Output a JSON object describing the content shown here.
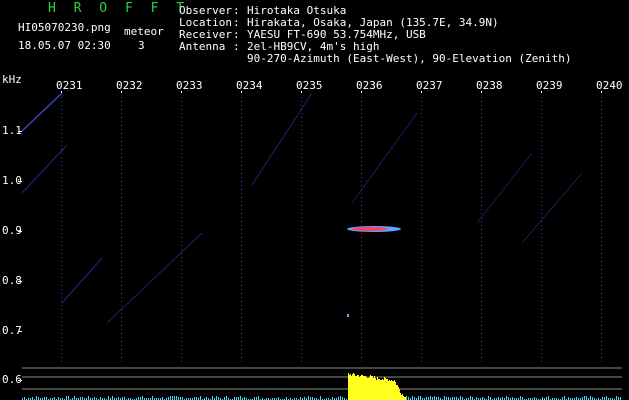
{
  "brand": "H R O F F T",
  "file_name": "HI05070230.png",
  "datetime": "18.05.07 02:30",
  "meteor_label": "meteor",
  "meteor_count": "3",
  "station": {
    "rows": [
      {
        "key": "Observer",
        "value": "Hirotaka Otsuka"
      },
      {
        "key": "Location",
        "value": "Hirakata, Osaka, Japan (135.7E, 34.9N)"
      },
      {
        "key": "Receiver",
        "value": "YAESU FT-690 53.754MHz, USB"
      },
      {
        "key": "Antenna",
        "value": "2el-HB9CV, 4m's high"
      },
      {
        "key": "",
        "value": "90-270-Azimuth (East-West), 90-Elevation (Zenith)"
      }
    ],
    "separator": ":"
  },
  "axis": {
    "unit": "kHz",
    "time_labels": [
      "0231",
      "0232",
      "0233",
      "0234",
      "0235",
      "0236",
      "0237",
      "0238",
      "0239",
      "0240"
    ],
    "freq_labels": [
      "1.1",
      "1.0",
      "0.9",
      "0.8",
      "0.7",
      "0.6"
    ]
  },
  "colors": {
    "brand": "#22d44a",
    "text": "#ffffff",
    "grid_dots": "#3a3aa8",
    "sweep_lines": "#3c46d0",
    "echo_core": "#ff4060",
    "echo_halo": "#58a8ff",
    "spectrum_burst": "#ffff20",
    "spectrum_noise": "#40d8ff"
  }
}
